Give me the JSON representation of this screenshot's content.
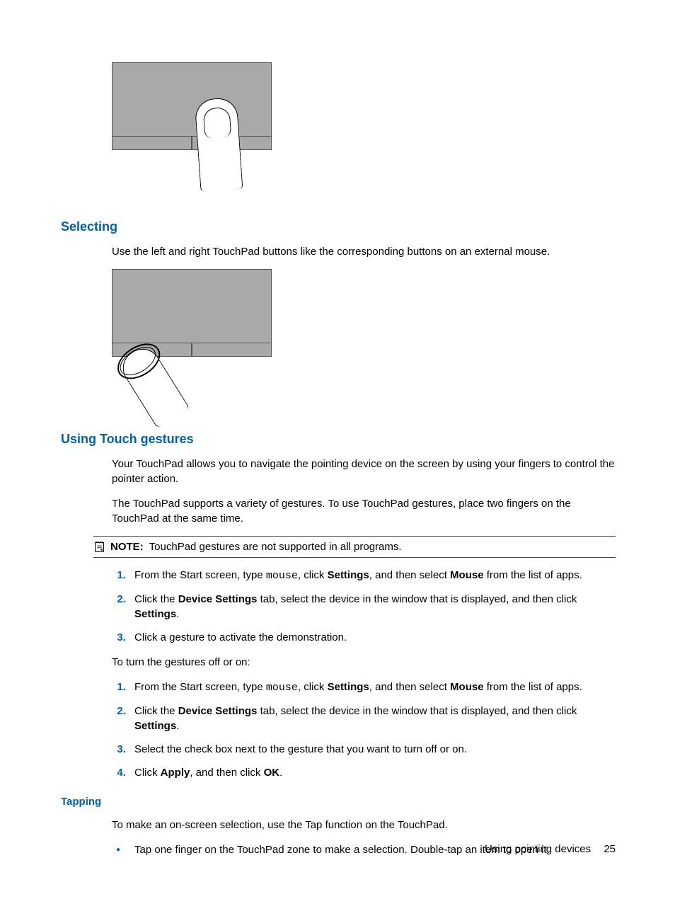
{
  "headings": {
    "selecting": "Selecting",
    "touch_gestures": "Using Touch gestures",
    "tapping": "Tapping"
  },
  "paragraphs": {
    "selecting_p1": "Use the left and right TouchPad buttons like the corresponding buttons on an external mouse.",
    "gestures_p1": "Your TouchPad allows you to navigate the pointing device on the screen by using your fingers to control the pointer action.",
    "gestures_p2": "The TouchPad supports a variety of gestures. To use TouchPad gestures, place two fingers on the TouchPad at the same time.",
    "gestures_p3": "To turn the gestures off or on:",
    "tapping_p1": "To make an on-screen selection, use the Tap function on the TouchPad."
  },
  "note": {
    "label": "NOTE:",
    "text": "TouchPad gestures are not supported in all programs."
  },
  "list1": {
    "i1_a": "From the Start screen, type ",
    "i1_mono": "mouse",
    "i1_b": ", click ",
    "i1_bold1": "Settings",
    "i1_c": ", and then select ",
    "i1_bold2": "Mouse",
    "i1_d": " from the list of apps.",
    "i2_a": "Click the ",
    "i2_bold1": "Device Settings",
    "i2_b": " tab, select the device in the window that is displayed, and then click ",
    "i2_bold2": "Settings",
    "i2_c": ".",
    "i3": "Click a gesture to activate the demonstration."
  },
  "list2": {
    "i1_a": "From the Start screen, type ",
    "i1_mono": "mouse",
    "i1_b": ", click ",
    "i1_bold1": "Settings",
    "i1_c": ", and then select ",
    "i1_bold2": "Mouse",
    "i1_d": " from the list of apps.",
    "i2_a": "Click the ",
    "i2_bold1": "Device Settings",
    "i2_b": " tab, select the device in the window that is displayed, and then click ",
    "i2_bold2": "Settings",
    "i2_c": ".",
    "i3": "Select the check box next to the gesture that you want to turn off or on.",
    "i4_a": "Click ",
    "i4_bold1": "Apply",
    "i4_b": ", and then click ",
    "i4_bold2": "OK",
    "i4_c": "."
  },
  "bullet": {
    "b1": "Tap one finger on the TouchPad zone to make a selection. Double-tap an item to open it."
  },
  "footer": {
    "section": "Using pointing devices",
    "page": "25"
  }
}
